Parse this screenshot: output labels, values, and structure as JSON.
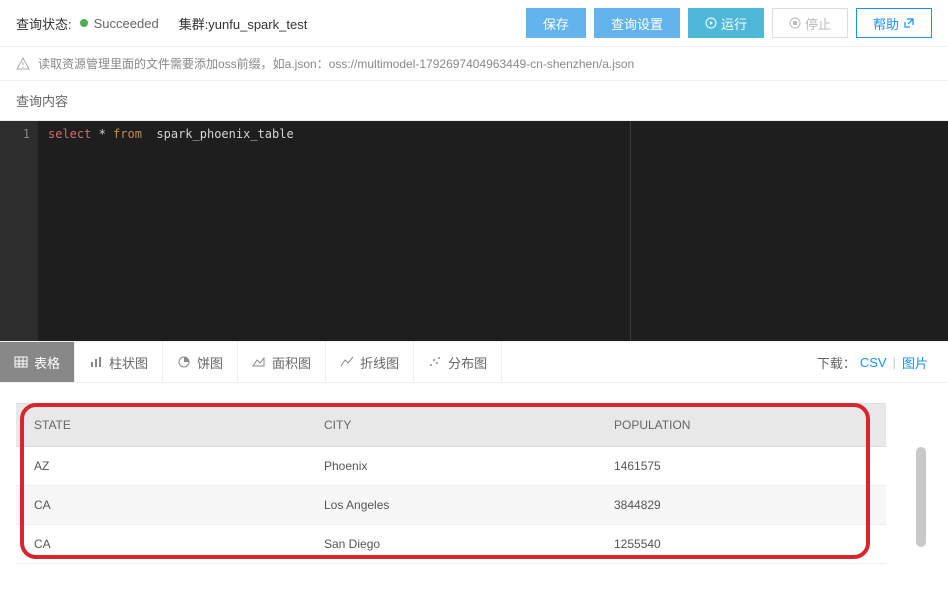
{
  "topbar": {
    "status_label": "查询状态:",
    "status_value": "Succeeded",
    "cluster_label": "集群:yunfu_spark_test",
    "buttons": {
      "save": "保存",
      "settings": "查询设置",
      "run": "运行",
      "stop": "停止",
      "help": "帮助"
    }
  },
  "warn": {
    "text": "读取资源管理里面的文件需要添加oss前缀，如a.json：oss://multimodel-1792697404963449-cn-shenzhen/a.json"
  },
  "section": {
    "title": "查询内容"
  },
  "editor": {
    "line_no": "1",
    "kw_select": "select",
    "kw_star_from": " * ",
    "kw_from": "from",
    "rest": "  spark_phoenix_table"
  },
  "tabs": {
    "table": "表格",
    "bar": "柱状图",
    "pie": "饼图",
    "area": "面积图",
    "line": "折线图",
    "scatter": "分布图"
  },
  "download": {
    "label": "下载：",
    "csv": "CSV",
    "img": "图片"
  },
  "results": {
    "headers": {
      "state": "STATE",
      "city": "CITY",
      "population": "POPULATION"
    },
    "rows": [
      {
        "state": "AZ",
        "city": "Phoenix",
        "population": "1461575"
      },
      {
        "state": "CA",
        "city": "Los Angeles",
        "population": "3844829"
      },
      {
        "state": "CA",
        "city": "San Diego",
        "population": "1255540"
      }
    ]
  }
}
